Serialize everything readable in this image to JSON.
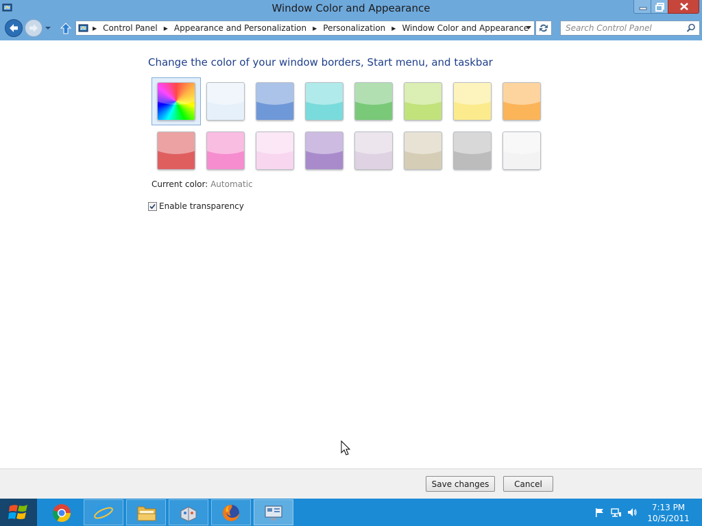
{
  "window": {
    "title": "Window Color and Appearance",
    "controls": {
      "minimize": "minimize",
      "maximize": "restore",
      "close": "close"
    }
  },
  "address_bar": {
    "breadcrumbs": [
      "Control Panel",
      "Appearance and Personalization",
      "Personalization",
      "Window Color and Appearance"
    ],
    "search_placeholder": "Search Control Panel"
  },
  "main": {
    "heading": "Change the color of your window borders, Start menu, and taskbar",
    "swatches": [
      {
        "name": "automatic",
        "selected": true
      },
      {
        "name": "sky",
        "color": "#e6f0fa"
      },
      {
        "name": "blue",
        "color": "#6f98d8"
      },
      {
        "name": "teal",
        "color": "#79dbdb"
      },
      {
        "name": "green",
        "color": "#79c979"
      },
      {
        "name": "lime",
        "color": "#c2e27c"
      },
      {
        "name": "yellow",
        "color": "#fbeb8c"
      },
      {
        "name": "orange",
        "color": "#fbb458"
      },
      {
        "name": "red",
        "color": "#df5f5f"
      },
      {
        "name": "pink",
        "color": "#f68dce"
      },
      {
        "name": "light-pink",
        "color": "#f8d6ef"
      },
      {
        "name": "purple",
        "color": "#a98bcc"
      },
      {
        "name": "lavender",
        "color": "#dfd2e2"
      },
      {
        "name": "taupe",
        "color": "#d6cdb6"
      },
      {
        "name": "gray",
        "color": "#bcbcbc"
      },
      {
        "name": "white",
        "color": "#f3f3f3"
      }
    ],
    "current_color_label": "Current color:",
    "current_color_value": "Automatic",
    "transparency_label": "Enable transparency",
    "transparency_checked": true
  },
  "buttons": {
    "save": "Save changes",
    "cancel": "Cancel"
  },
  "taskbar": {
    "apps": [
      "Google Chrome",
      "Internet Explorer",
      "Windows Explorer",
      "Paint",
      "Firefox",
      "Control Panel"
    ],
    "time": "7:13 PM",
    "date": "10/5/2011"
  },
  "colors": {
    "titlebar": "#6ea9dc",
    "taskbar": "#1b8bd6",
    "heading": "#1e3e8a"
  }
}
